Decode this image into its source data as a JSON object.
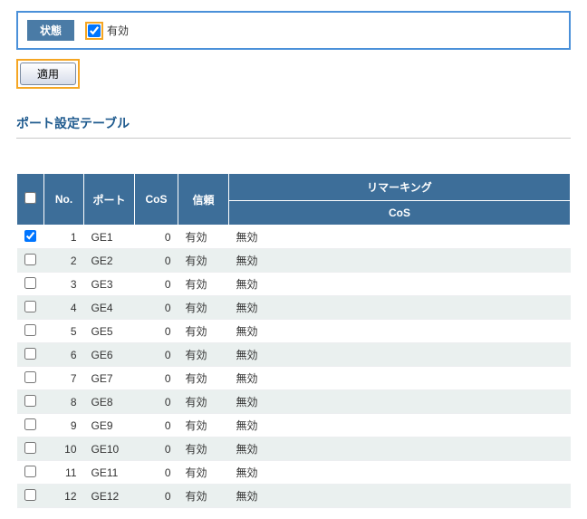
{
  "state": {
    "label": "状態",
    "enable_text": "有効",
    "enable_checked": true
  },
  "apply_button": "適用",
  "section_title": "ポート設定テーブル",
  "table": {
    "headers": {
      "no": "No.",
      "port": "ポート",
      "cos": "CoS",
      "trust": "信頼",
      "remarking_group": "リマーキング",
      "remarking_cos": "CoS"
    },
    "rows": [
      {
        "checked": true,
        "no": 1,
        "port": "GE1",
        "cos": 0,
        "trust": "有効",
        "remarking_cos": "無効"
      },
      {
        "checked": false,
        "no": 2,
        "port": "GE2",
        "cos": 0,
        "trust": "有効",
        "remarking_cos": "無効"
      },
      {
        "checked": false,
        "no": 3,
        "port": "GE3",
        "cos": 0,
        "trust": "有効",
        "remarking_cos": "無効"
      },
      {
        "checked": false,
        "no": 4,
        "port": "GE4",
        "cos": 0,
        "trust": "有効",
        "remarking_cos": "無効"
      },
      {
        "checked": false,
        "no": 5,
        "port": "GE5",
        "cos": 0,
        "trust": "有効",
        "remarking_cos": "無効"
      },
      {
        "checked": false,
        "no": 6,
        "port": "GE6",
        "cos": 0,
        "trust": "有効",
        "remarking_cos": "無効"
      },
      {
        "checked": false,
        "no": 7,
        "port": "GE7",
        "cos": 0,
        "trust": "有効",
        "remarking_cos": "無効"
      },
      {
        "checked": false,
        "no": 8,
        "port": "GE8",
        "cos": 0,
        "trust": "有効",
        "remarking_cos": "無効"
      },
      {
        "checked": false,
        "no": 9,
        "port": "GE9",
        "cos": 0,
        "trust": "有効",
        "remarking_cos": "無効"
      },
      {
        "checked": false,
        "no": 10,
        "port": "GE10",
        "cos": 0,
        "trust": "有効",
        "remarking_cos": "無効"
      },
      {
        "checked": false,
        "no": 11,
        "port": "GE11",
        "cos": 0,
        "trust": "有効",
        "remarking_cos": "無効"
      },
      {
        "checked": false,
        "no": 12,
        "port": "GE12",
        "cos": 0,
        "trust": "有効",
        "remarking_cos": "無効"
      }
    ]
  }
}
